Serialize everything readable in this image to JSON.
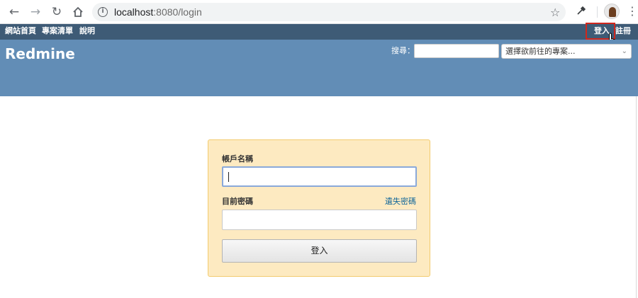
{
  "browser": {
    "url_host": "localhost",
    "url_path": ":8080/login",
    "icons": [
      "back-icon",
      "forward-icon",
      "reload-icon",
      "home-icon",
      "info-icon",
      "star-icon",
      "eyedropper-icon",
      "avatar",
      "more-icon"
    ]
  },
  "top_menu": {
    "items": [
      {
        "label": "網站首頁"
      },
      {
        "label": "專案清單"
      },
      {
        "label": "說明"
      }
    ],
    "account": {
      "login": "登入",
      "register": "註冊"
    }
  },
  "header": {
    "title": "Redmine",
    "search_label": "搜尋：",
    "search_value": "",
    "project_jump_placeholder": "選擇欲前往的專案..."
  },
  "login": {
    "username_label": "帳戶名稱",
    "username_value": "",
    "password_label": "目前密碼",
    "password_value": "",
    "lost_password": "遺失密碼",
    "submit_label": "登入"
  },
  "colors": {
    "top_menu_bg": "#3e5b76",
    "header_bg": "#628db6",
    "login_box_bg": "#fdeac1",
    "login_box_border": "#f2cb6e",
    "highlight": "#d0271d",
    "link": "#116699"
  }
}
